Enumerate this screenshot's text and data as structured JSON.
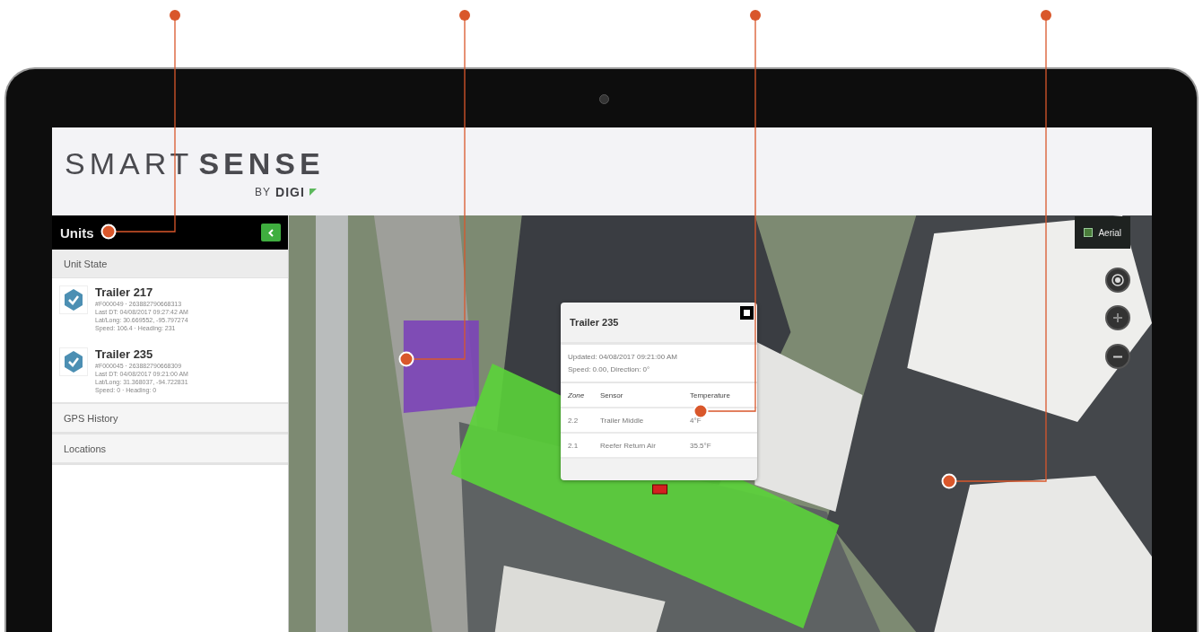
{
  "brand": {
    "name_light": "SMART",
    "name_bold": "SENSE",
    "by": "BY",
    "maker": "DIGI"
  },
  "sidebar": {
    "title": "Units",
    "sections": [
      {
        "label": "Unit State",
        "expanded": true,
        "units": [
          {
            "name": "Trailer 217",
            "checked": true,
            "id_line": "#F000049 · 263882790668313",
            "last_dt": "Last DT: 04/08/2017 09:27:42 AM",
            "lat_long": "Lat/Long: 30.669552, -95.797274",
            "speed_heading": "Speed: 106.4 · Heading: 231"
          },
          {
            "name": "Trailer 235",
            "checked": true,
            "id_line": "#F000045 · 263882790668309",
            "last_dt": "Last DT: 04/08/2017 09:21:00 AM",
            "lat_long": "Lat/Long: 31.368037, -94.722831",
            "speed_heading": "Speed: 0 · Heading: 0"
          }
        ]
      },
      {
        "label": "GPS History"
      },
      {
        "label": "Locations"
      }
    ]
  },
  "map": {
    "layer_button": "Aerial",
    "popup": {
      "title": "Trailer 235",
      "updated": "Updated: 04/08/2017 09:21:00 AM",
      "speed_direction": "Speed: 0.00, Direction: 0°",
      "columns": [
        "Zone",
        "Sensor",
        "Temperature"
      ],
      "rows": [
        [
          "2.2",
          "Trailer Middle",
          "4°F"
        ],
        [
          "2.1",
          "Reefer Return Air",
          "35.5°F"
        ]
      ]
    }
  }
}
